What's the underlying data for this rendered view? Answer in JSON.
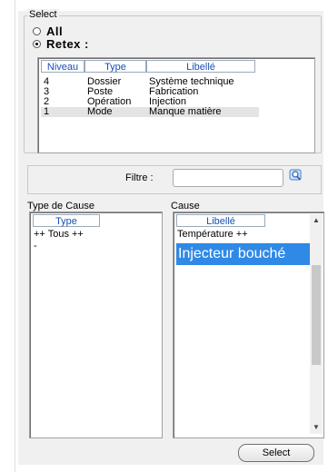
{
  "select_group": {
    "legend": "Select",
    "opt_all": "All",
    "opt_retex": "Retex :"
  },
  "retex_table": {
    "headers": [
      "Niveau",
      "Type",
      "Libellé"
    ],
    "rows": [
      [
        "4",
        "Dossier",
        "Système technique"
      ],
      [
        "3",
        "Poste",
        "Fabrication"
      ],
      [
        "2",
        "Opération",
        "Injection"
      ],
      [
        "1",
        "Mode",
        "Manque matière"
      ]
    ],
    "selected_row": 3
  },
  "filter": {
    "label": "Filtre :",
    "value": ""
  },
  "type_cause": {
    "label": "Type de Cause",
    "header": "Type",
    "items": [
      "++ Tous ++",
      "-"
    ]
  },
  "cause": {
    "label": "Cause",
    "header": "Libellé",
    "items": [
      "Température ++",
      "Injecteur bouché"
    ],
    "selected_index": 1
  },
  "buttons": {
    "select": "Select"
  },
  "colors": {
    "selection": "#2f89e6",
    "header_text": "#1a4fb4"
  }
}
